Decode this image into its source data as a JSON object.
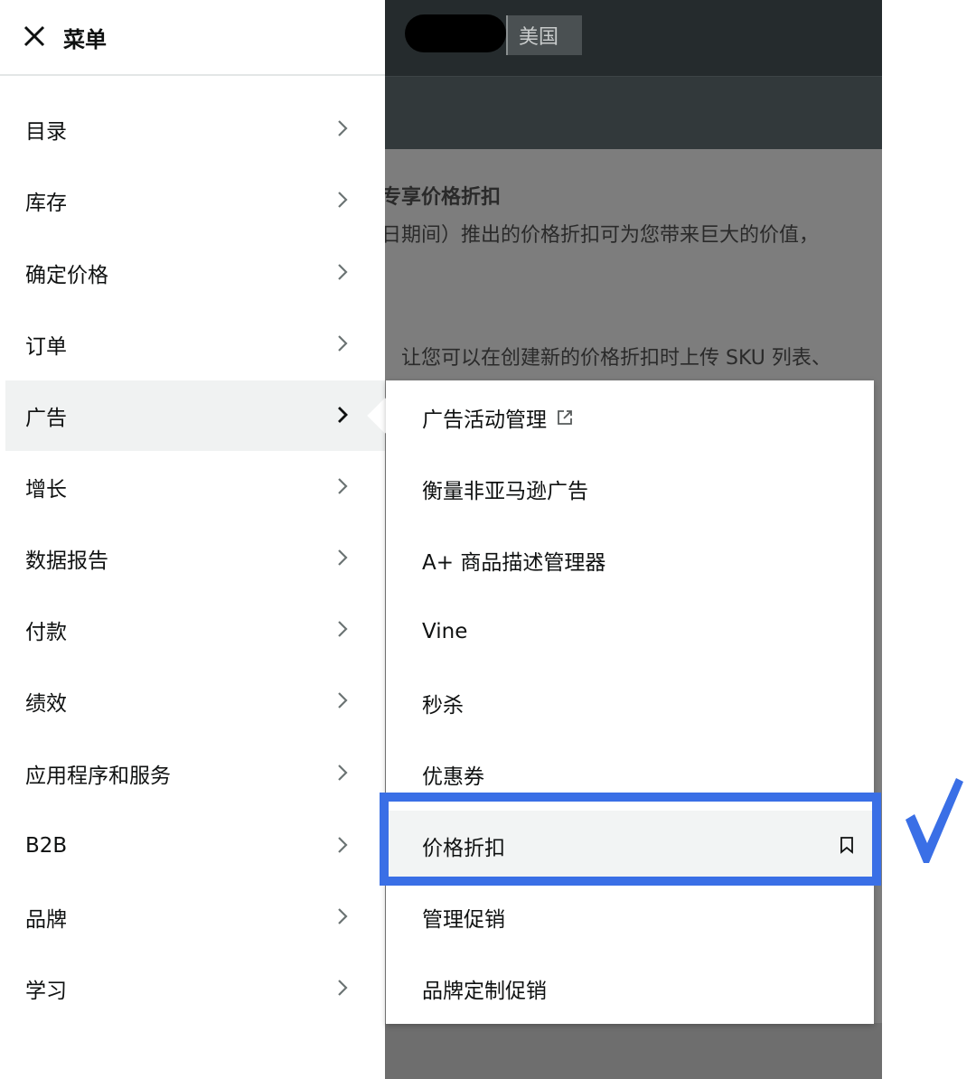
{
  "background": {
    "region_label": "美国",
    "text_lines": [
      "专享价格折扣",
      "日期间）推出的价格折扣可为您带来巨大的价值，",
      "让您可以在创建新的价格折扣时上传 SKU 列表、"
    ]
  },
  "drawer": {
    "title": "菜单",
    "items": [
      {
        "label": "目录"
      },
      {
        "label": "库存"
      },
      {
        "label": "确定价格"
      },
      {
        "label": "订单"
      },
      {
        "label": "广告"
      },
      {
        "label": "增长"
      },
      {
        "label": "数据报告"
      },
      {
        "label": "付款"
      },
      {
        "label": "绩效"
      },
      {
        "label": "应用程序和服务"
      },
      {
        "label": "B2B"
      },
      {
        "label": "品牌"
      },
      {
        "label": "学习"
      }
    ],
    "active_item": "广告"
  },
  "submenu": {
    "items": [
      {
        "label": "广告活动管理",
        "icon": "external-link-icon"
      },
      {
        "label": "衡量非亚马逊广告"
      },
      {
        "label": "A+ 商品描述管理器"
      },
      {
        "label": "Vine"
      },
      {
        "label": "秒杀"
      },
      {
        "label": "优惠券"
      },
      {
        "label": "价格折扣",
        "icon": "bookmark-icon"
      },
      {
        "label": "管理促销"
      },
      {
        "label": "品牌定制促销"
      }
    ],
    "selected_item": "价格折扣"
  },
  "annotation": {
    "box_color": "#3a6fe6",
    "check_color": "#3a6fe6"
  }
}
